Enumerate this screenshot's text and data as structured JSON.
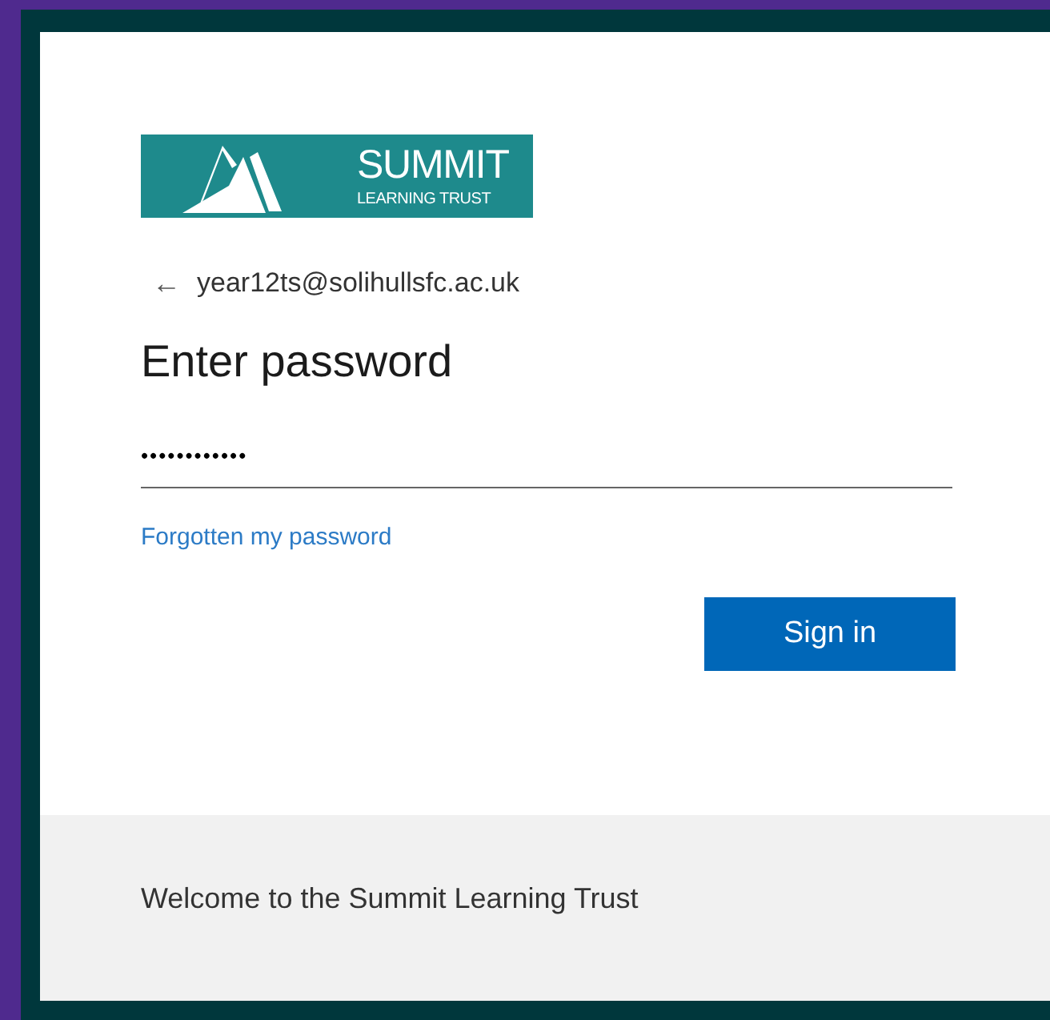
{
  "logo": {
    "title": "SUMMIT",
    "subtitle": "LEARNING TRUST"
  },
  "account": {
    "back_arrow": "←",
    "email": "year12ts@solihullsfc.ac.uk"
  },
  "heading": "Enter password",
  "password_field": {
    "value": "••••••••••••"
  },
  "forgot_link": "Forgotten my password",
  "sign_in_button": "Sign in",
  "footer": {
    "text": "Welcome to the Summit Learning Trust"
  }
}
